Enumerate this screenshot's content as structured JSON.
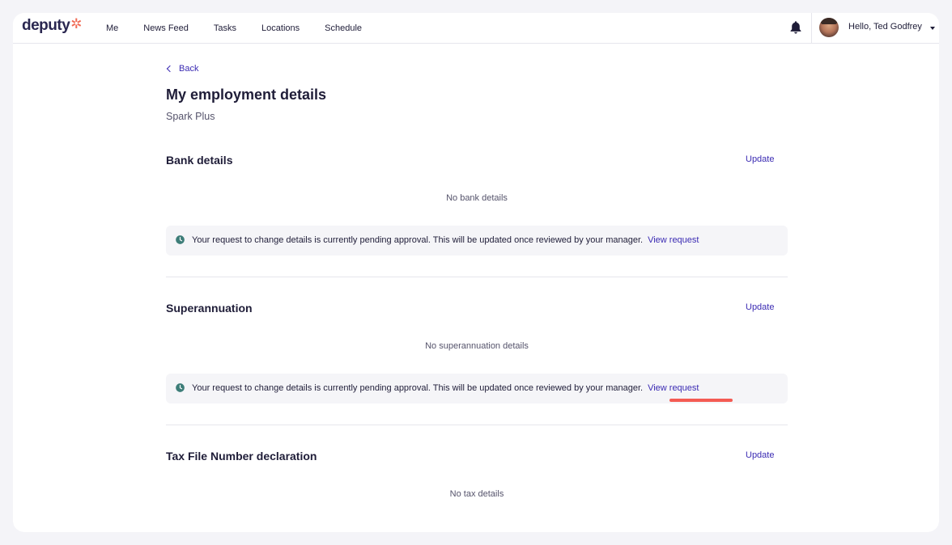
{
  "brand": {
    "name": "deputy",
    "mark": "✲",
    "accent": "#f06b55"
  },
  "nav": {
    "items": [
      "Me",
      "News Feed",
      "Tasks",
      "Locations",
      "Schedule"
    ]
  },
  "header": {
    "greeting": "Hello, Ted Godfrey",
    "bell_icon": "bell-icon"
  },
  "page": {
    "back_label": "Back",
    "title": "My employment details",
    "subtitle": "Spark Plus"
  },
  "sections": [
    {
      "title": "Bank details",
      "update_label": "Update",
      "empty_text": "No bank details",
      "notice": {
        "text": "Your request to change details is currently pending approval. This will be updated once reviewed by your manager.",
        "link": "View request"
      }
    },
    {
      "title": "Superannuation",
      "update_label": "Update",
      "empty_text": "No superannuation details",
      "notice": {
        "text": "Your request to change details is currently pending approval. This will be updated once reviewed by your manager.",
        "link": "View request"
      }
    },
    {
      "title": "Tax File Number declaration",
      "update_label": "Update",
      "empty_text": "No tax details"
    }
  ],
  "colors": {
    "link": "#3b2bb3",
    "clock_icon": "#3d7d78",
    "highlight_mark": "#f3524a"
  }
}
